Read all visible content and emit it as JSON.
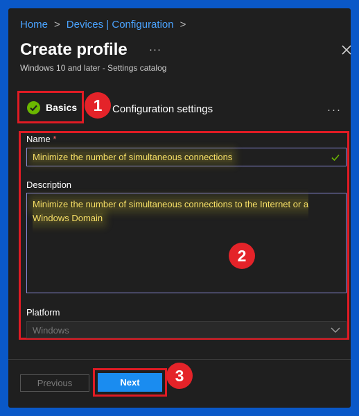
{
  "breadcrumb": {
    "home": "Home",
    "separator": ">",
    "devices": "Devices | Configuration"
  },
  "header": {
    "title": "Create profile",
    "more": "···",
    "subtitle": "Windows 10 and later - Settings catalog"
  },
  "tabs": [
    {
      "label": "Basics",
      "status": "complete",
      "icon": "check-circle-icon"
    },
    {
      "label": "Configuration settings"
    }
  ],
  "tabs_more": "···",
  "annotations": [
    "1",
    "2",
    "3"
  ],
  "form": {
    "name_label": "Name",
    "required_marker": "*",
    "name_value": "Minimize the number of simultaneous connections",
    "description_label": "Description",
    "description_value": "Minimize the number of simultaneous connections to the Internet or a Windows Domain",
    "platform_label": "Platform",
    "platform_value": "Windows"
  },
  "footer": {
    "previous_label": "Previous",
    "next_label": "Next"
  },
  "colors": {
    "accent": "#1a8cf0",
    "annotation": "#e01b24",
    "success": "#6bb700",
    "highlight_text": "#f7e066",
    "background": "#0a58c8",
    "panel": "#1f1f1f"
  }
}
